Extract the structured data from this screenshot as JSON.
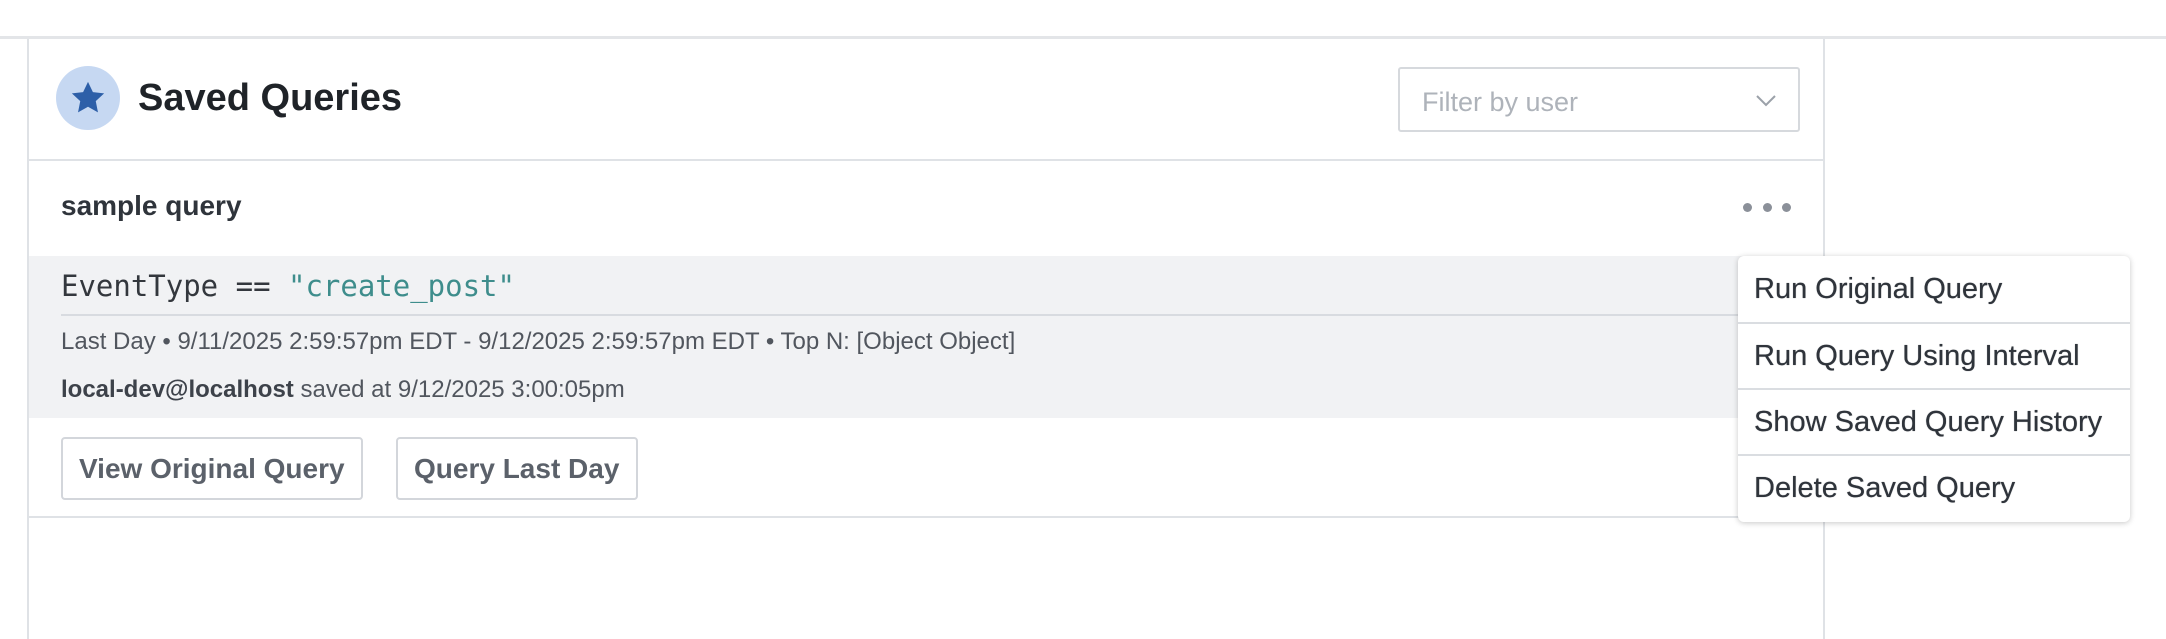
{
  "panel": {
    "title": "Saved Queries",
    "title_icon": "star-icon",
    "filter": {
      "placeholder": "Filter by user",
      "icon": "chevron-down-icon"
    }
  },
  "queries": [
    {
      "name": "sample query",
      "menu_icon": "more-horizontal-icon",
      "code": {
        "field": "EventType",
        "operator": "==",
        "value": "\"create_post\""
      },
      "meta": "Last Day • 9/11/2025 2:59:57pm EDT - 9/12/2025 2:59:57pm EDT • Top N: [Object Object]",
      "saved_by": "local-dev@localhost",
      "saved_text": "saved at 9/12/2025 3:00:05pm",
      "actions": {
        "view_original": "View Original Query",
        "query_last_day": "Query Last Day"
      }
    }
  ],
  "context_menu": {
    "items": [
      "Run Original Query",
      "Run Query Using Interval",
      "Show Saved Query History",
      "Delete Saved Query"
    ]
  },
  "colors": {
    "accent": "#2d5fa8",
    "badge_bg": "#c6d8f2",
    "code_string": "#3e8d8c",
    "code_bg": "#f1f2f4"
  }
}
